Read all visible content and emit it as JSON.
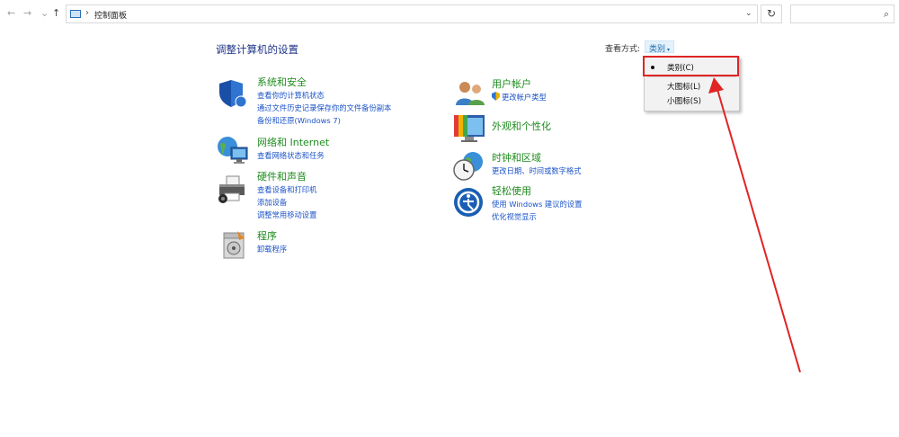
{
  "nav": {
    "back": "←",
    "forward": "→",
    "recent": "⌄",
    "up": "↑"
  },
  "address": {
    "separator": "›",
    "location": "控制面板",
    "dropdown": "⌄"
  },
  "refresh": "↻",
  "search": {
    "value": "",
    "icon": "⌕"
  },
  "main": {
    "title": "调整计算机的设置",
    "view_by_label": "查看方式:",
    "view_by_value": "类别",
    "view_by_caret": "▾",
    "left_column": [
      {
        "title": "系统和安全",
        "links": [
          "查看你的计算机状态",
          "通过文件历史记录保存你的文件备份副本",
          "备份和还原(Windows 7)"
        ]
      },
      {
        "title": "网络和 Internet",
        "links": [
          "查看网络状态和任务"
        ]
      },
      {
        "title": "硬件和声音",
        "links": [
          "查看设备和打印机",
          "添加设备",
          "调整常用移动设置"
        ]
      },
      {
        "title": "程序",
        "links": [
          "卸载程序"
        ]
      }
    ],
    "right_column": [
      {
        "title": "用户帐户",
        "links": [
          "更改帐户类型"
        ]
      },
      {
        "title": "外观和个性化",
        "links": []
      },
      {
        "title": "时钟和区域",
        "links": [
          "更改日期、时间或数字格式"
        ]
      },
      {
        "title": "轻松使用",
        "links": [
          "使用 Windows 建议的设置",
          "优化视觉显示"
        ]
      }
    ]
  },
  "view_menu": {
    "items": [
      "类别(C)",
      "大图标(L)",
      "小图标(S)"
    ],
    "selected": "类别(C)"
  },
  "colors": {
    "category_title": "#1e8b1e",
    "link": "#1a52c8",
    "title": "#1e3287",
    "annotation": "#e02424"
  }
}
